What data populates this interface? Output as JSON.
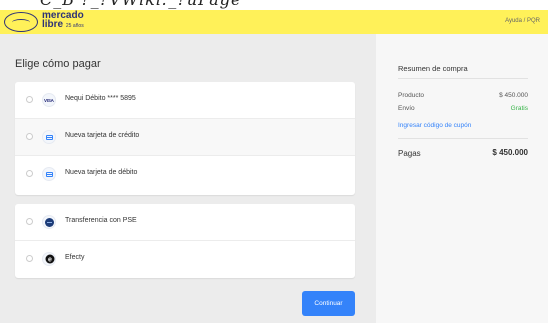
{
  "title_overlay": "C_B    ?_?VWiki:_?uPage",
  "header": {
    "logo_line1": "mercado",
    "logo_line2": "libre",
    "logo_tag": "25 años",
    "help_label": "Ayuda / PQR"
  },
  "main": {
    "title": "Elige cómo pagar",
    "payment_groups": [
      {
        "options": [
          {
            "label": "Nequi Débito **** 5895",
            "icon": "visa-icon"
          },
          {
            "label": "Nueva tarjeta de crédito",
            "icon": "credit-card-icon"
          },
          {
            "label": "Nueva tarjeta de débito",
            "icon": "debit-card-icon"
          }
        ]
      },
      {
        "options": [
          {
            "label": "Transferencia con PSE",
            "icon": "pse-icon"
          },
          {
            "label": "Efecty",
            "icon": "efecty-icon"
          }
        ]
      }
    ],
    "continue_label": "Continuar",
    "visa_text": "VISA"
  },
  "summary": {
    "title": "Resumen de compra",
    "product_label": "Producto",
    "product_value": "$ 450.000",
    "shipping_label": "Envío",
    "shipping_value": "Gratis",
    "coupon_label": "Ingresar código de cupón",
    "total_label": "Pagas",
    "total_value": "$ 450.000"
  },
  "colors": {
    "header_yellow": "#fff159",
    "brand_blue": "#2d3277",
    "primary_blue": "#3483fa",
    "free_green": "#39b54a"
  }
}
